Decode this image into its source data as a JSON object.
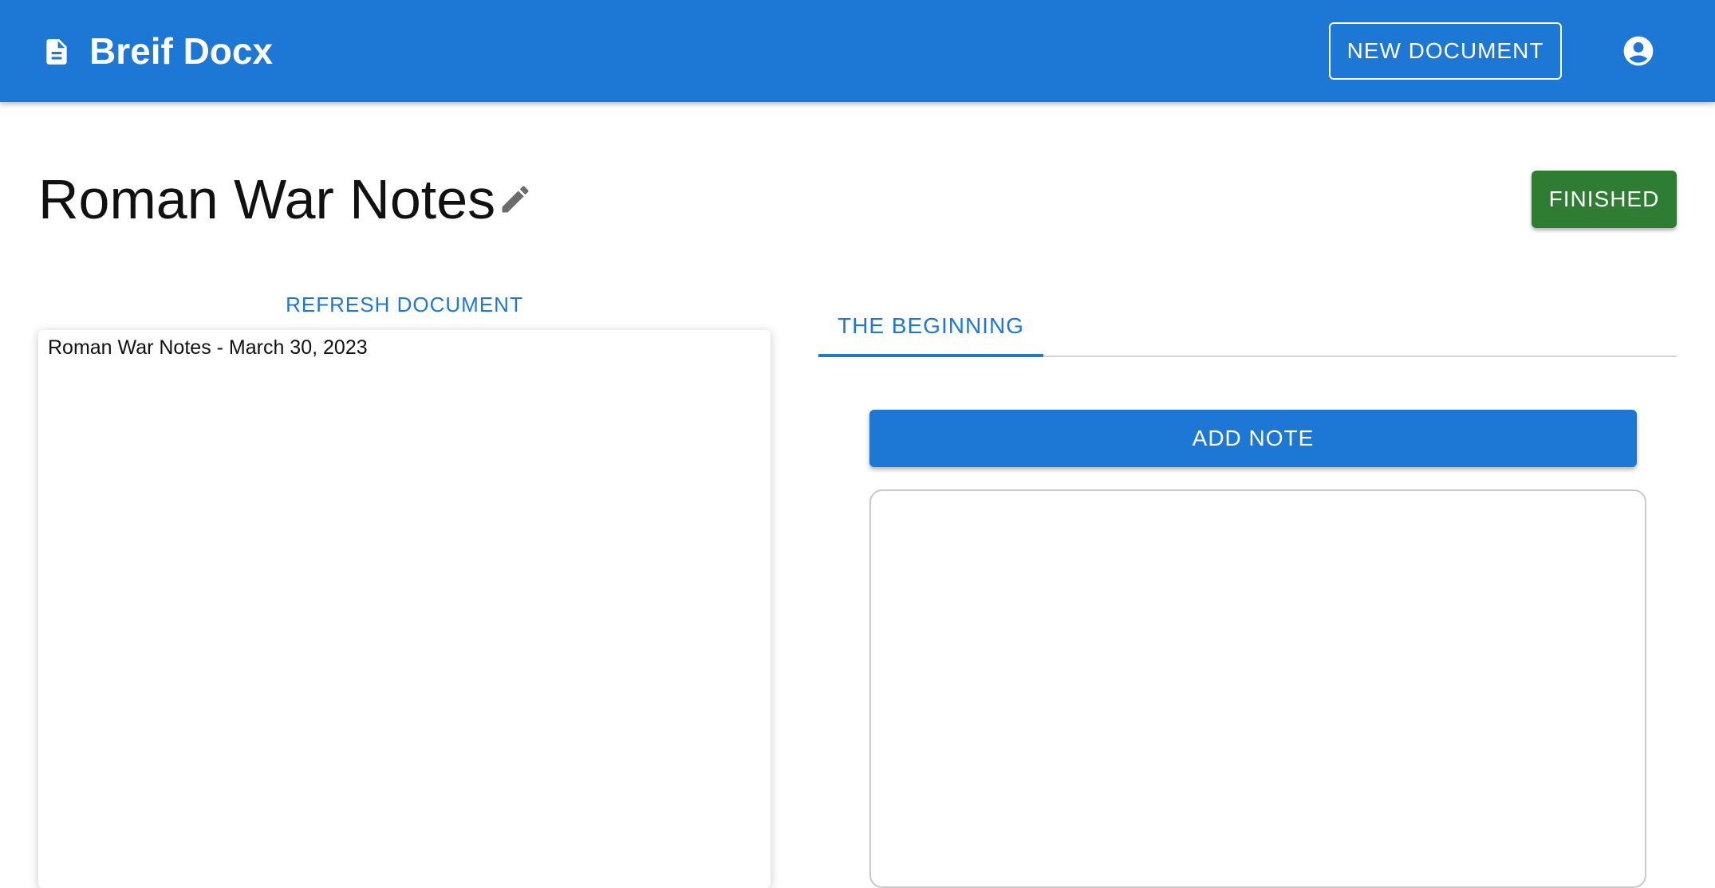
{
  "appbar": {
    "brand_icon": "document-icon",
    "title": "Breif Docx",
    "new_document_label": "NEW DOCUMENT",
    "account_icon": "account-circle-icon",
    "color": "#1c77d5"
  },
  "header": {
    "title": "Roman War Notes",
    "edit_icon": "pencil-icon",
    "finished_label": "FINISHED",
    "finished_color": "#2e7d32"
  },
  "document": {
    "refresh_label": "REFRESH DOCUMENT",
    "content": "Roman War Notes - March 30, 2023"
  },
  "notes": {
    "tabs": [
      {
        "label": "THE BEGINNING",
        "selected": true
      }
    ],
    "add_note_label": "ADD NOTE",
    "note_value": ""
  }
}
